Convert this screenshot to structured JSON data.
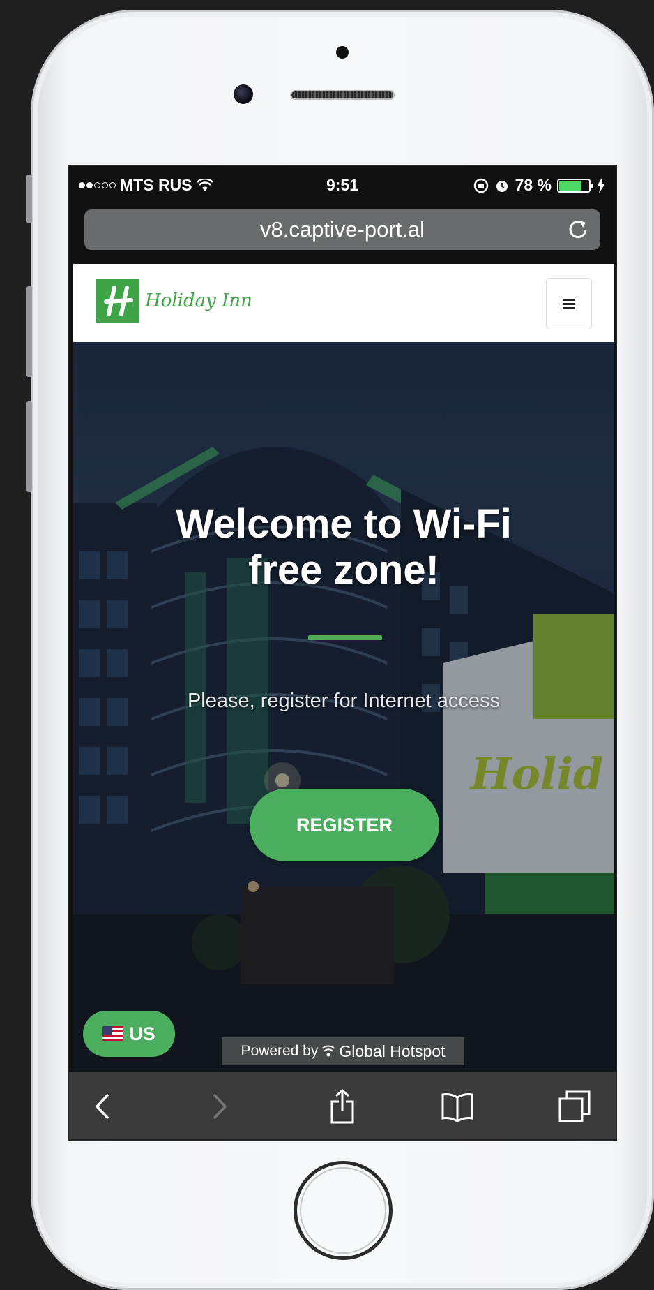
{
  "status_bar": {
    "carrier": "MTS RUS",
    "time": "9:51",
    "battery_percent": "78 %",
    "battery_level": 0.78
  },
  "browser": {
    "url": "v8.captive-port.al"
  },
  "site": {
    "brand_name": "Holiday Inn",
    "brand_color": "#3fa447"
  },
  "hero": {
    "title_line1": "Welcome to Wi-Fi",
    "title_line2": "free zone!",
    "subtitle": "Please, register for Internet access",
    "register_label": "REGISTER",
    "accent_color": "#4caf5f"
  },
  "language": {
    "label": "US"
  },
  "footer": {
    "powered_by": "Powered by",
    "provider": "Global Hotspot"
  },
  "icons": {
    "wifi": "wifi-icon",
    "lock_rotation": "orientation-lock-icon",
    "alarm": "alarm-icon",
    "charging": "bolt-icon",
    "reload": "reload-icon",
    "menu": "hamburger-icon",
    "back": "chevron-left-icon",
    "forward": "chevron-right-icon",
    "share": "share-icon",
    "bookmarks": "book-icon",
    "tabs": "tabs-icon"
  }
}
